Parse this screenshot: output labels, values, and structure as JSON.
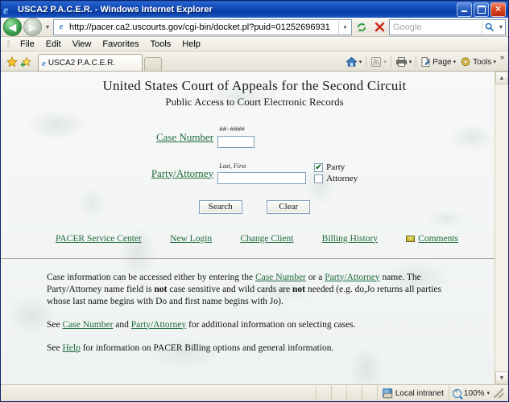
{
  "window": {
    "title": "USCA2 P.A.C.E.R. - Windows Internet Explorer",
    "minimize_label": "Minimize",
    "maximize_label": "Maximize",
    "close_label": "Close"
  },
  "browser": {
    "back_label": "Back",
    "forward_label": "Forward",
    "history_caret": "▾",
    "url": "http://pacer.ca2.uscourts.gov/cgi-bin/docket.pl?puid=01252696931",
    "url_caret": "▾",
    "refresh_label": "Refresh",
    "stop_label": "Stop",
    "search_placeholder": "Google",
    "search_go_label": "Search",
    "menu": [
      {
        "label": "File",
        "accel": "F"
      },
      {
        "label": "Edit",
        "accel": "E"
      },
      {
        "label": "View",
        "accel": "V"
      },
      {
        "label": "Favorites",
        "accel": "a"
      },
      {
        "label": "Tools",
        "accel": "T"
      },
      {
        "label": "Help",
        "accel": "H"
      }
    ],
    "favorites_label": "Favorites Center",
    "add_favorite_label": "Add to Favorites",
    "tab_label": "USCA2 P.A.C.E.R.",
    "new_tab_label": "New Tab",
    "toolbar": {
      "home_label": "Home",
      "home_caret": "▾",
      "feeds_label": "Feeds",
      "feeds_caret": "▾",
      "print_label": "Print",
      "print_caret": "▾",
      "page_label": "Page",
      "page_caret": "▾",
      "tools_label": "Tools",
      "tools_caret": "▾",
      "overflow_label": "»"
    }
  },
  "page": {
    "title": "United States Court of Appeals for the Second Circuit",
    "subtitle": "Public Access to Court Electronic Records",
    "form": {
      "case_number_label": "Case Number",
      "case_number_hint": "##-####",
      "case_number_value": "",
      "party_attorney_label": "Party/Attorney",
      "party_attorney_hint": "Last, First",
      "party_attorney_value": "",
      "party_checkbox_label": "Party",
      "party_checked": true,
      "attorney_checkbox_label": "Attorney",
      "attorney_checked": false,
      "check_glyph": "✔",
      "search_button": "Search",
      "clear_button": "Clear"
    },
    "nav_links": [
      {
        "label": "PACER Service Center",
        "icon": ""
      },
      {
        "label": "New Login",
        "icon": ""
      },
      {
        "label": "Change Client",
        "icon": ""
      },
      {
        "label": "Billing History",
        "icon": ""
      },
      {
        "label": "Comments",
        "icon": "envelope-icon"
      }
    ],
    "paragraphs": {
      "p1_a": "Case information can be accessed either by entering the ",
      "p1_link1": "Case Number",
      "p1_b": " or a ",
      "p1_link2": "Party/Attorney",
      "p1_c": " name. The Party/Attorney name field is ",
      "p1_bold1": "not",
      "p1_d": " case sensitive and wild cards are ",
      "p1_bold2": "not",
      "p1_e": " needed (e.g. do,Jo returns all parties whose last name begins with Do and first name begins with Jo).",
      "p2_a": "See ",
      "p2_link1": "Case Number",
      "p2_b": " and ",
      "p2_link2": "Party/Attorney",
      "p2_c": " for additional information on selecting cases.",
      "p3_a": "See ",
      "p3_link1": "Help",
      "p3_b": " for information on PACER Billing options and general information."
    }
  },
  "statusbar": {
    "message": "",
    "zone": "Local intranet",
    "zoom": "100%",
    "zoom_caret": "▾"
  },
  "colors": {
    "link_green": "#1f6b3e",
    "titlebar_blue": "#0b3fa8",
    "check_green": "#1f7a3a"
  }
}
